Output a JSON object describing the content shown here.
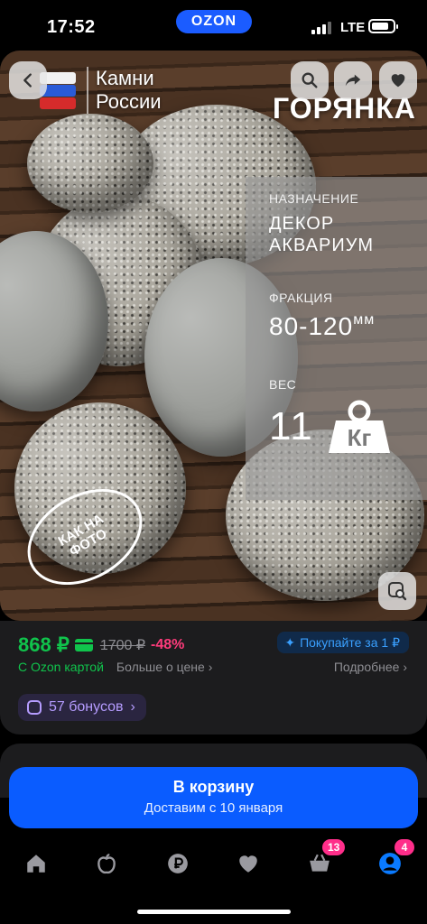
{
  "status_bar": {
    "time": "17:52",
    "network": "LTE",
    "ozon_pill": "OZON"
  },
  "product_image": {
    "brand_line1": "Камни",
    "brand_line2": "России",
    "title": "ГОРЯНКА",
    "specs": {
      "purpose_label": "НАЗНАЧЕНИЕ",
      "purpose_line1": "ДЕКОР",
      "purpose_line2": "АКВАРИУМ",
      "fraction_label": "ФРАКЦИЯ",
      "fraction_value": "80-120",
      "fraction_unit": "мм",
      "weight_label": "ВЕС",
      "weight_value": "11",
      "weight_unit": "Кг"
    },
    "stamp_line1": "КАК НА",
    "stamp_line2": "ФОТО"
  },
  "price": {
    "main": "868 ₽",
    "old": "1700 ₽",
    "discount": "-48%",
    "buy_for": "Покупайте за 1 ₽",
    "ozon_card": "С Ozon картой",
    "more_price": "Больше о цене",
    "details": "Подробнее",
    "bonus": "57 бонусов"
  },
  "cart_button": {
    "label": "В корзину",
    "delivery": "Доставим с 10 января"
  },
  "tabbar": {
    "cart_badge": "13",
    "profile_badge": "4"
  },
  "colors": {
    "accent_blue": "#0a5cff",
    "price_green": "#10c44c",
    "discount_pink": "#ff3b7b",
    "badge_pink": "#ff2e8a"
  }
}
